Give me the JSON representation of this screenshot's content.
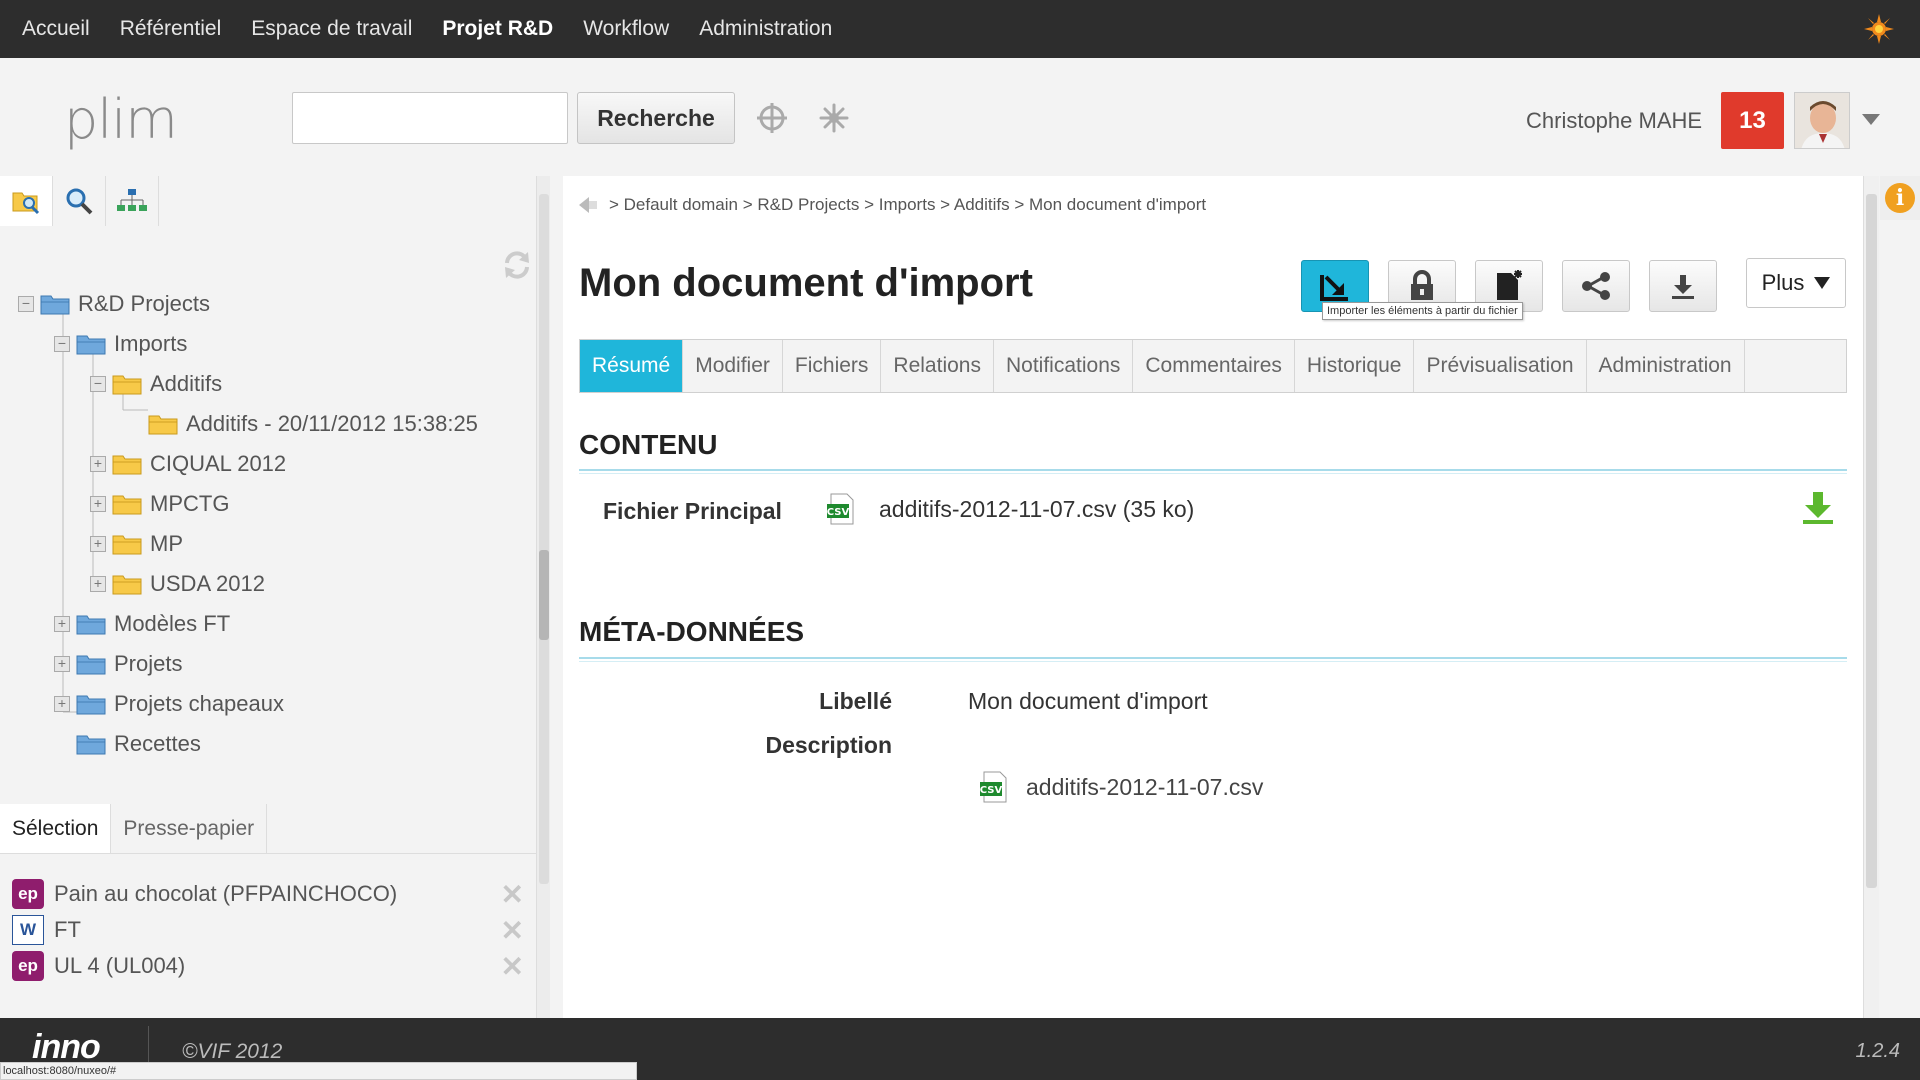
{
  "nav": {
    "items": [
      "Accueil",
      "Référentiel",
      "Espace de travail",
      "Projet R&D",
      "Workflow",
      "Administration"
    ],
    "active_index": 3
  },
  "header": {
    "logo": "plim",
    "search_placeholder": "",
    "search_value": "",
    "search_button": "Recherche",
    "username": "Christophe MAHE",
    "notifications": "13"
  },
  "left": {
    "tree": [
      {
        "label": "R&D Projects",
        "level": 0,
        "expander": "−",
        "folder": "blue"
      },
      {
        "label": "Imports",
        "level": 1,
        "expander": "−",
        "folder": "blue"
      },
      {
        "label": "Additifs",
        "level": 2,
        "expander": "−",
        "folder": "yellow"
      },
      {
        "label": "Additifs - 20/11/2012 15:38:25",
        "level": 3,
        "expander": "",
        "folder": "yellow"
      },
      {
        "label": "CIQUAL 2012",
        "level": 2,
        "expander": "+",
        "folder": "yellow"
      },
      {
        "label": "MPCTG",
        "level": 2,
        "expander": "+",
        "folder": "yellow"
      },
      {
        "label": "MP",
        "level": 2,
        "expander": "+",
        "folder": "yellow"
      },
      {
        "label": "USDA 2012",
        "level": 2,
        "expander": "+",
        "folder": "yellow"
      },
      {
        "label": "Modèles FT",
        "level": 1,
        "expander": "+",
        "folder": "blue"
      },
      {
        "label": "Projets",
        "level": 1,
        "expander": "+",
        "folder": "blue"
      },
      {
        "label": "Projets chapeaux",
        "level": 1,
        "expander": "+",
        "folder": "blue"
      },
      {
        "label": "Recettes",
        "level": 1,
        "expander": "",
        "folder": "blue"
      }
    ],
    "selection_tabs": [
      "Sélection",
      "Presse-papier"
    ],
    "selection_items": [
      {
        "badge": "ep",
        "label": "Pain au chocolat (PFPAINCHOCO)"
      },
      {
        "badge": "W",
        "label": "FT"
      },
      {
        "badge": "ep",
        "label": "UL 4 (UL004)"
      }
    ]
  },
  "main": {
    "breadcrumb": "> Default domain > R&D Projects > Imports > Additifs > Mon document d'import",
    "title": "Mon document d'import",
    "tooltip": "Importer les éléments à partir du fichier",
    "plus_label": "Plus",
    "tabs": [
      "Résumé",
      "Modifier",
      "Fichiers",
      "Relations",
      "Notifications",
      "Commentaires",
      "Historique",
      "Prévisualisation",
      "Administration"
    ],
    "active_tab": 0,
    "content_title": "CONTENU",
    "main_file_label": "Fichier Principal",
    "main_file": "additifs-2012-11-07.csv (35 ko)",
    "meta_title": "MÉTA-DONNÉES",
    "libelle_label": "Libellé",
    "libelle_value": "Mon document d'import",
    "description_label": "Description",
    "description_file": "additifs-2012-11-07.csv"
  },
  "footer": {
    "logo": "inno",
    "copyright": "©VIF 2012",
    "version": "1.2.4",
    "status_url": "localhost:8080/nuxeo/#"
  },
  "colors": {
    "accent": "#1fb6da",
    "notif": "#e03a2c",
    "nav_bg": "#2d2d2d",
    "ep_badge": "#8f1d6d"
  }
}
